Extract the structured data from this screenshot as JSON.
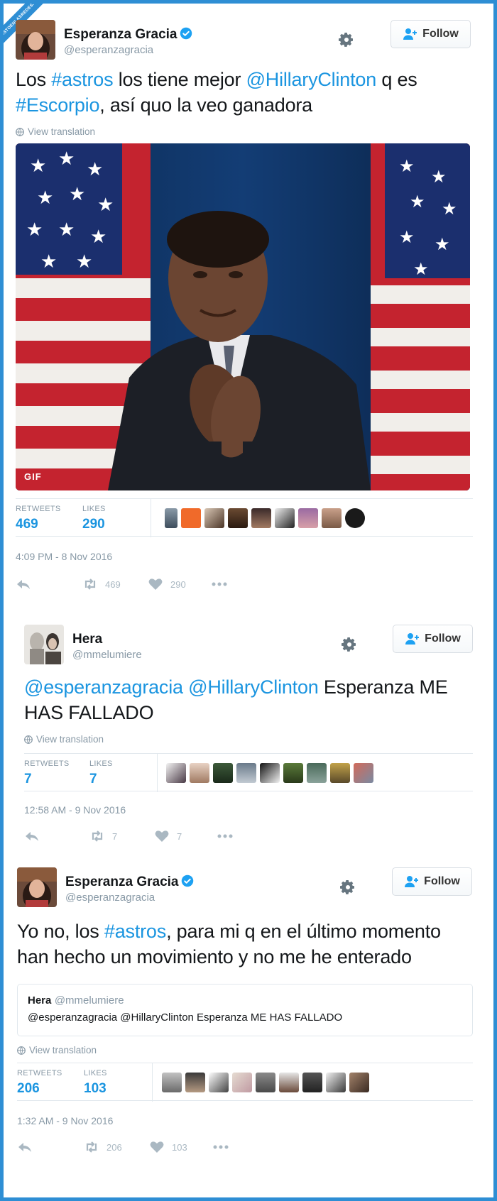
{
  "watermark": "VISTOENLASREDES.COM",
  "follow_label": "Follow",
  "view_translation": "View translation",
  "labels": {
    "retweets": "RETWEETS",
    "likes": "LIKES"
  },
  "media_badge": "GIF",
  "colors": {
    "link": "#1b95e0",
    "border": "#2e8ed4",
    "muted": "#8899a6"
  },
  "tweets": [
    {
      "name": "Esperanza Gracia",
      "handle": "@esperanzagracia",
      "verified": true,
      "text_parts": [
        "Los ",
        "#astros",
        " los tiene mejor ",
        "@HillaryClinton",
        " q es ",
        "#Escorpio",
        ", así quo la veo ganadora"
      ],
      "retweets": "469",
      "likes": "290",
      "time": "4:09 PM - 8 Nov 2016",
      "action_retweets": "469",
      "action_likes": "290"
    },
    {
      "name": "Hera",
      "handle": "@mmelumiere",
      "verified": false,
      "text_parts": [
        "@esperanzagracia",
        " ",
        "@HillaryClinton",
        " Esperanza ME HAS FALLADO"
      ],
      "retweets": "7",
      "likes": "7",
      "time": "12:58 AM - 9 Nov 2016",
      "action_retweets": "7",
      "action_likes": "7"
    },
    {
      "name": "Esperanza Gracia",
      "handle": "@esperanzagracia",
      "verified": true,
      "text_parts": [
        "Yo no, los ",
        "#astros",
        ", para mi q en el último momento han hecho un movimiento y no me he enterado"
      ],
      "quote": {
        "name": "Hera",
        "handle": "@mmelumiere",
        "text": "@esperanzagracia @HillaryClinton Esperanza ME HAS FALLADO"
      },
      "retweets": "206",
      "likes": "103",
      "time": "1:32 AM - 9 Nov 2016",
      "action_retweets": "206",
      "action_likes": "103"
    }
  ]
}
